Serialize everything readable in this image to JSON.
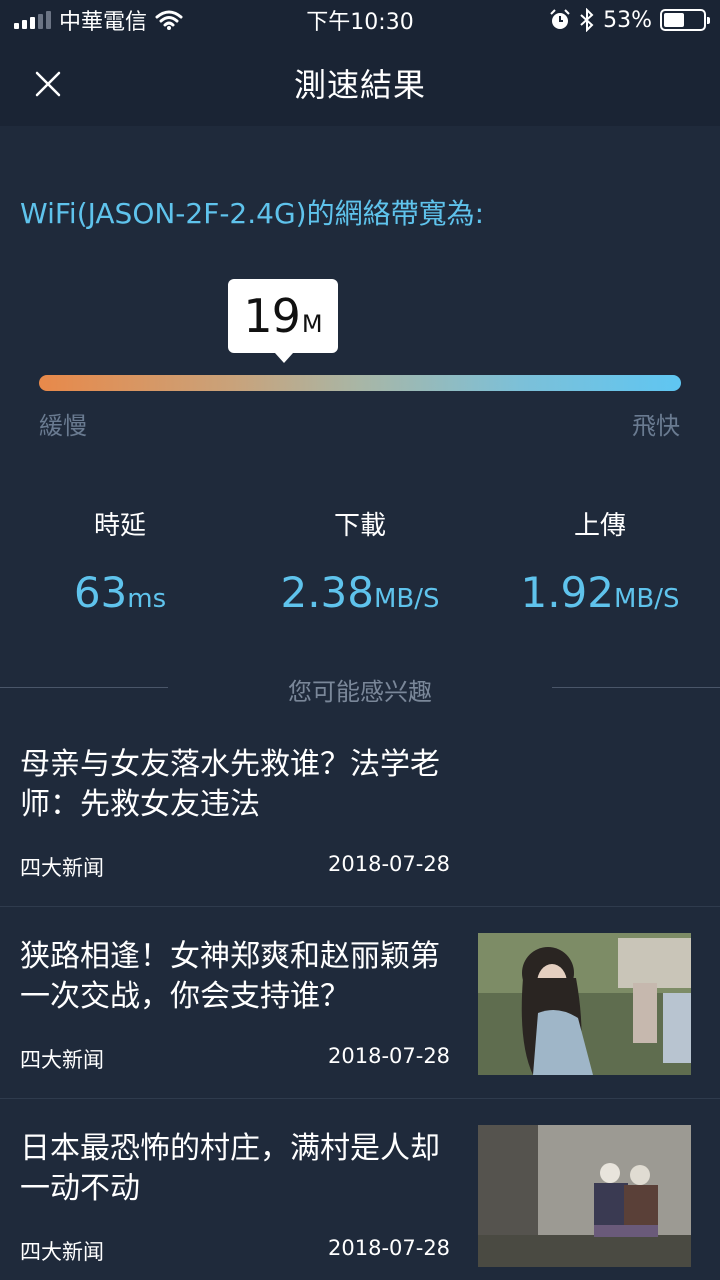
{
  "status_bar": {
    "carrier": "中華電信",
    "time": "下午10:30",
    "battery_percent": "53%",
    "battery_level": 0.53,
    "icons": [
      "signal-icon",
      "wifi-icon",
      "alarm-icon",
      "bluetooth-icon",
      "battery-icon"
    ]
  },
  "header": {
    "title": "測速結果",
    "close_icon": "close-icon"
  },
  "result": {
    "network_line": "WiFi(JASON-2F-2.4G)的網絡帶寬為:",
    "bandwidth_value": "19",
    "bandwidth_unit": "M",
    "slow_label": "緩慢",
    "fast_label": "飛快",
    "gradient_colors": [
      "#e8894a",
      "#5fc6f2"
    ]
  },
  "metrics": [
    {
      "label": "時延",
      "value": "63",
      "unit": "ms"
    },
    {
      "label": "下載",
      "value": "2.38",
      "unit": "MB/S"
    },
    {
      "label": "上傳",
      "value": "1.92",
      "unit": "MB/S"
    }
  ],
  "interest": {
    "label": "您可能感兴趣"
  },
  "news": [
    {
      "title": "母亲与女友落水先救谁？法学老师：先救女友违法",
      "source": "四大新闻",
      "date": "2018-07-28"
    },
    {
      "title": "狭路相逢！女神郑爽和赵丽颖第一次交战，你会支持谁？",
      "source": "四大新闻",
      "date": "2018-07-28"
    },
    {
      "title": "日本最恐怖的村庄，满村是人却一动不动",
      "source": "四大新闻",
      "date": "2018-07-28"
    }
  ],
  "colors": {
    "background": "#1f2a3b",
    "header": "#1a2434",
    "accent": "#5fc3ec",
    "muted": "#6a7b91"
  }
}
